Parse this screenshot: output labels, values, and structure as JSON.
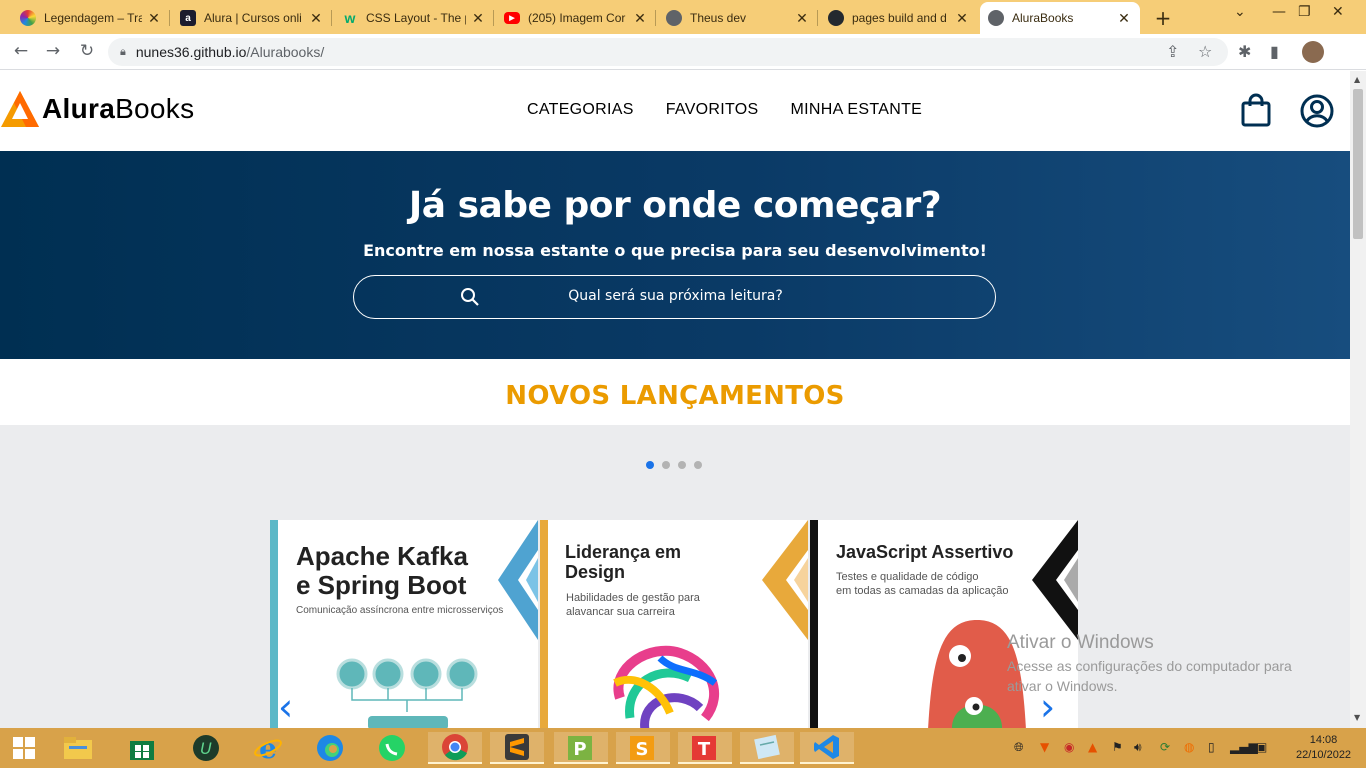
{
  "browser": {
    "tabs": [
      {
        "title": "Legendagem – Tra",
        "icon": "colorwheel-favicon-icon",
        "color": "#d63384"
      },
      {
        "title": "Alura | Cursos onli",
        "icon": "alura-favicon-icon",
        "color": "#1c1c2e"
      },
      {
        "title": "CSS Layout - The p",
        "icon": "w3schools-favicon-icon",
        "color": "#04aa6d"
      },
      {
        "title": "(205) Imagem Cor",
        "icon": "youtube-favicon-icon",
        "color": "#ff0000"
      },
      {
        "title": "Theus dev",
        "icon": "globe-favicon-icon",
        "color": "#5f6368"
      },
      {
        "title": "pages build and d",
        "icon": "github-favicon-icon",
        "color": "#24292f"
      },
      {
        "title": "AluraBooks",
        "icon": "globe-favicon-icon",
        "color": "#5f6368"
      }
    ],
    "url_host": "nunes36.github.io",
    "url_path": "/Alurabooks/"
  },
  "site": {
    "brand_bold": "Alura",
    "brand_rest": "Books",
    "nav": [
      "CATEGORIAS",
      "FAVORITOS",
      "MINHA ESTANTE"
    ],
    "hero_title": "Já sabe por onde começar?",
    "hero_subtitle": "Encontre em nossa estante o que precisa para seu desenvolvimento!",
    "search_placeholder": "Qual será sua próxima leitura?",
    "section_title": "NOVOS LANÇAMENTOS",
    "carousel": {
      "dots": 4,
      "active": 0
    },
    "books": [
      {
        "title_line1": "Apache Kafka",
        "title_line2": "e Spring Boot",
        "subtitle_line1": "Comunicação assíncrona entre microsserviços",
        "subtitle_line2": "",
        "accent": "#4fa3d1"
      },
      {
        "title_line1": "Liderança em",
        "title_line2": "Design",
        "subtitle_line1": "Habilidades de gestão para",
        "subtitle_line2": "alavancar sua carreira",
        "accent": "#e8a93b"
      },
      {
        "title_line1": "JavaScript Assertivo",
        "title_line2": "",
        "subtitle_line1": "Testes e qualidade de código",
        "subtitle_line2": "em todas as camadas da aplicação",
        "accent": "#111111"
      }
    ],
    "colors": {
      "hero": "#002f52",
      "accent_orange": "#eb9b00",
      "carousel_blue": "#1a73e8"
    }
  },
  "watermark": {
    "title": "Ativar o Windows",
    "line1": "Acesse as configurações do computador para",
    "line2": "ativar o Windows."
  },
  "taskbar": {
    "apps": [
      "windows-start-icon",
      "file-explorer-icon",
      "microsoft-store-icon",
      "upwork-icon",
      "internet-explorer-icon",
      "edge-icon",
      "whatsapp-icon",
      "chrome-icon",
      "sublime-text-icon",
      "project-icon",
      "slides-icon",
      "typora-icon",
      "notepad-icon",
      "vscode-icon"
    ],
    "time": "14:08",
    "date": "22/10/2022"
  }
}
